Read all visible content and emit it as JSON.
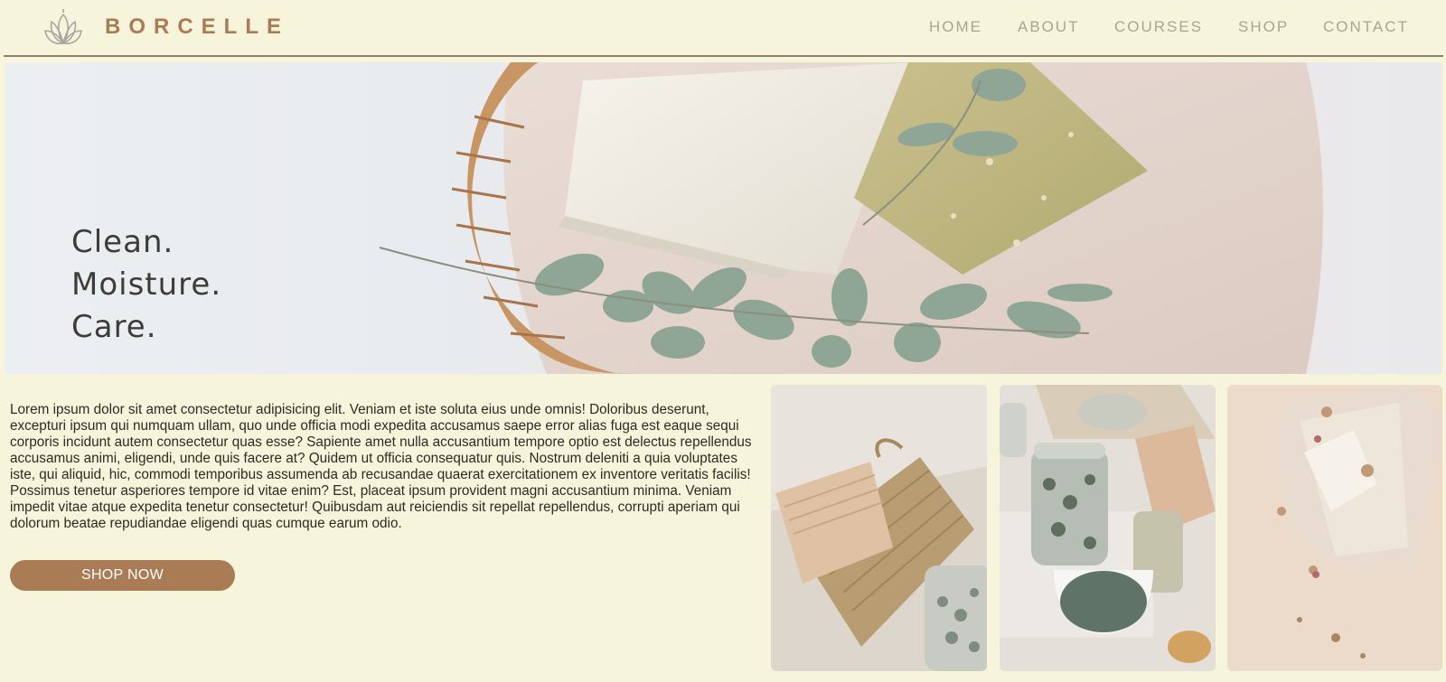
{
  "header": {
    "brand": "BORCELLE",
    "logo_icon": "lotus-icon",
    "nav": [
      {
        "label": "HOME"
      },
      {
        "label": "ABOUT"
      },
      {
        "label": "COURSES"
      },
      {
        "label": "SHOP"
      },
      {
        "label": "CONTACT"
      }
    ]
  },
  "hero": {
    "tagline": [
      "Clean.",
      "Moisture.",
      "Care."
    ]
  },
  "content": {
    "body": "Lorem ipsum dolor sit amet consectetur adipisicing elit. Veniam et iste soluta eius unde omnis! Doloribus deserunt, excepturi ipsum qui numquam ullam, quo unde officia modi expedita accusamus saepe error alias fuga est eaque sequi corporis incidunt autem consectetur quas esse? Sapiente amet nulla accusantium tempore optio est delectus repellendus accusamus animi, eligendi, unde quis facere at? Quidem ut officia consequatur quis. Nostrum deleniti a quia voluptates iste, qui aliquid, hic, commodi temporibus assumenda ab recusandae quaerat exercitationem ex inventore veritatis facilis! Possimus tenetur asperiores tempore id vitae enim? Est, placeat ipsum provident magni accusantium minima. Veniam impedit vitae atque expedita tenetur consectetur! Quibusdam aut reiciendis sit repellat repellendus, corrupti aperiam qui dolorum beatae repudiandae eligendi quas cumque earum odio.",
    "cta": "SHOP NOW"
  },
  "colors": {
    "background": "#f6f4da",
    "brand": "#a97c55",
    "nav_text": "#a8a597",
    "button": "#a97c55"
  }
}
